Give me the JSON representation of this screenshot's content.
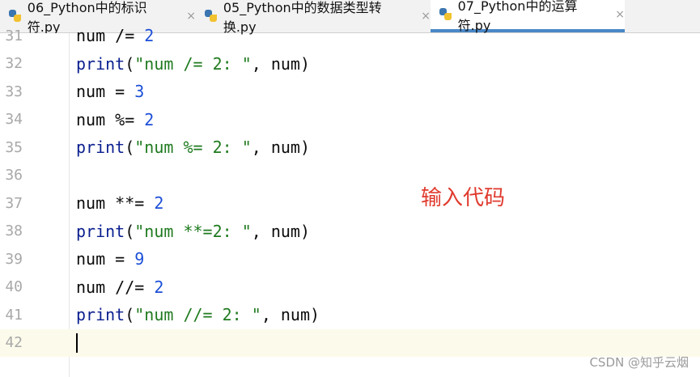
{
  "tabs": [
    {
      "label": "06_Python中的标识符.py",
      "close": "×",
      "active": false
    },
    {
      "label": "05_Python中的数据类型转换.py",
      "close": "×",
      "active": false
    },
    {
      "label": "07_Python中的运算符.py",
      "close": "×",
      "active": true
    }
  ],
  "editor": {
    "lines": [
      {
        "number": "31",
        "parts": [
          {
            "t": "num /= "
          },
          {
            "t": "2",
            "c": "num"
          }
        ]
      },
      {
        "number": "32",
        "parts": [
          {
            "t": "print",
            "c": "kw"
          },
          {
            "t": "("
          },
          {
            "t": "\"num /= 2: \"",
            "c": "str"
          },
          {
            "t": ", num)"
          }
        ]
      },
      {
        "number": "33",
        "parts": [
          {
            "t": "num = "
          },
          {
            "t": "3",
            "c": "num"
          }
        ]
      },
      {
        "number": "34",
        "parts": [
          {
            "t": "num %= "
          },
          {
            "t": "2",
            "c": "num"
          }
        ]
      },
      {
        "number": "35",
        "parts": [
          {
            "t": "print",
            "c": "kw"
          },
          {
            "t": "("
          },
          {
            "t": "\"num %= 2: \"",
            "c": "str"
          },
          {
            "t": ", num)"
          }
        ]
      },
      {
        "number": "36",
        "parts": []
      },
      {
        "number": "37",
        "parts": [
          {
            "t": "num **= "
          },
          {
            "t": "2",
            "c": "num"
          }
        ]
      },
      {
        "number": "38",
        "parts": [
          {
            "t": "print",
            "c": "kw"
          },
          {
            "t": "("
          },
          {
            "t": "\"num **=2: \"",
            "c": "str"
          },
          {
            "t": ", num)"
          }
        ]
      },
      {
        "number": "39",
        "parts": [
          {
            "t": "num = "
          },
          {
            "t": "9",
            "c": "num"
          }
        ]
      },
      {
        "number": "40",
        "parts": [
          {
            "t": "num //= "
          },
          {
            "t": "2",
            "c": "num"
          }
        ]
      },
      {
        "number": "41",
        "parts": [
          {
            "t": "print",
            "c": "kw"
          },
          {
            "t": "("
          },
          {
            "t": "\"num //= 2: \"",
            "c": "str"
          },
          {
            "t": ", num)"
          }
        ]
      },
      {
        "number": "42",
        "parts": [],
        "current": true
      }
    ]
  },
  "annotation": "输入代码",
  "watermark": "CSDN @知乎云烟",
  "colors": {
    "accent": "#4a88c7",
    "keyword": "#0a1f8f",
    "string": "#1f7a1f",
    "number": "#1c4fd8",
    "annotation": "#e03a2e"
  }
}
